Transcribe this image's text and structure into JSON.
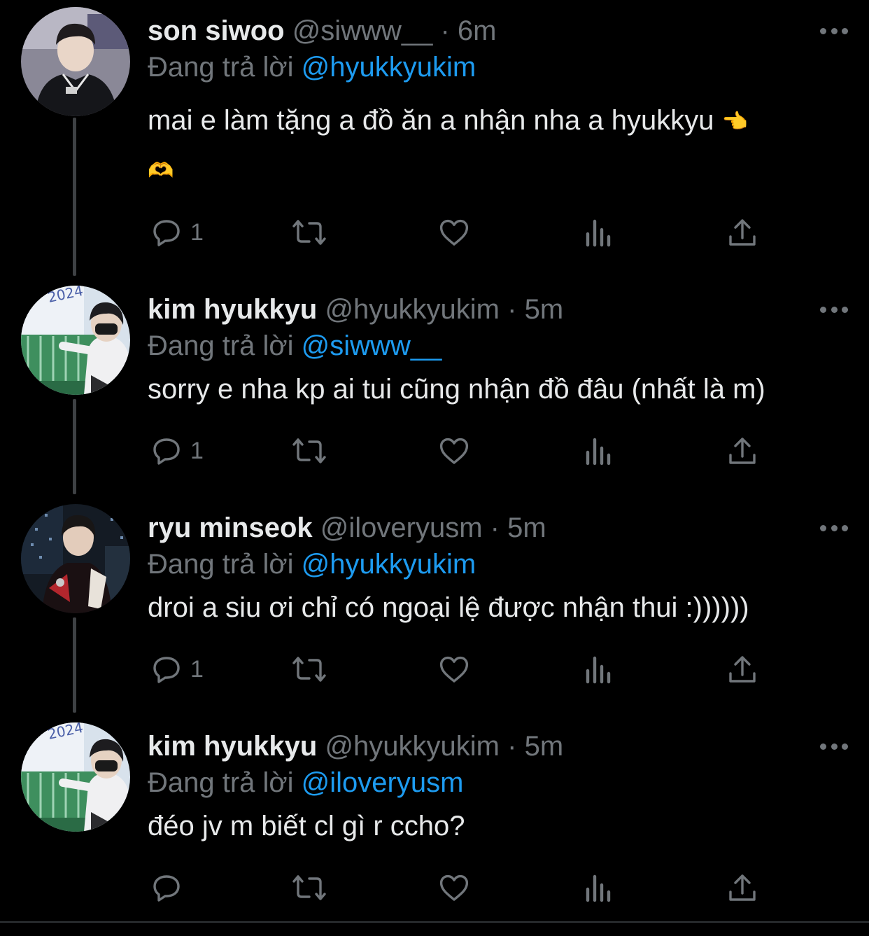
{
  "colors": {
    "background": "#000000",
    "primary_text": "#e7e9ea",
    "secondary_text": "#71767b",
    "mention": "#1d9bf0",
    "thread_line": "#3e4144"
  },
  "tweets": [
    {
      "display_name": "son siwoo",
      "handle": "@siwww__",
      "time": "6m",
      "reply_prefix": "Đang trả lời",
      "reply_to": "@hyukkyukim",
      "text": "mai e làm tặng a đồ ăn a nhận nha a hyukkyu",
      "emoji_1": "👈",
      "emoji_2": "🫶",
      "reply_count": "1"
    },
    {
      "display_name": "kim hyukkyu",
      "handle": "@hyukkyukim",
      "time": "5m",
      "reply_prefix": "Đang trả lời",
      "reply_to": "@siwww__",
      "text": "sorry e nha kp ai tui cũng nhận đồ đâu (nhất là m)",
      "reply_count": "1"
    },
    {
      "display_name": "ryu minseok",
      "handle": "@iloveryusm",
      "time": "5m",
      "reply_prefix": "Đang trả lời",
      "reply_to": "@hyukkyukim",
      "text": "droi a siu ơi chỉ có ngoại lệ được nhận thui :))))))",
      "reply_count": "1"
    },
    {
      "display_name": "kim hyukkyu",
      "handle": "@hyukkyukim",
      "time": "5m",
      "reply_prefix": "Đang trả lời",
      "reply_to": "@iloveryusm",
      "text": "đéo jv m biết cl gì r ccho?",
      "reply_count": ""
    }
  ],
  "icons": {
    "reply": "reply-icon",
    "retweet": "retweet-icon",
    "like": "like-icon",
    "views": "views-icon",
    "share": "share-icon",
    "more": "more-icon"
  }
}
